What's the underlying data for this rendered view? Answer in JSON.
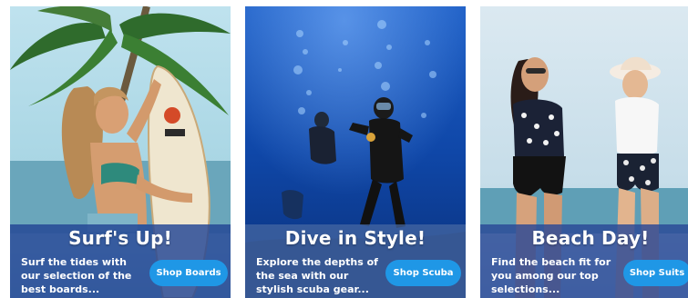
{
  "cards": [
    {
      "title": "Surf's Up!",
      "description": "Surf the tides with our selection of the best boards...",
      "button_label": "Shop Boards",
      "image": "surfer-with-surfboard-photo"
    },
    {
      "title": "Dive in Style!",
      "description": "Explore the depths of the sea with our stylish scuba gear...",
      "button_label": "Shop Scuba",
      "image": "scuba-divers-underwater-photo"
    },
    {
      "title": "Beach Day!",
      "description": "Find the beach fit for you among our top selections...",
      "button_label": "Shop Suits",
      "image": "two-women-in-swimwear-photo"
    }
  ],
  "colors": {
    "button": "#1f97e6",
    "overlay": "#224494",
    "text": "#ffffff"
  }
}
